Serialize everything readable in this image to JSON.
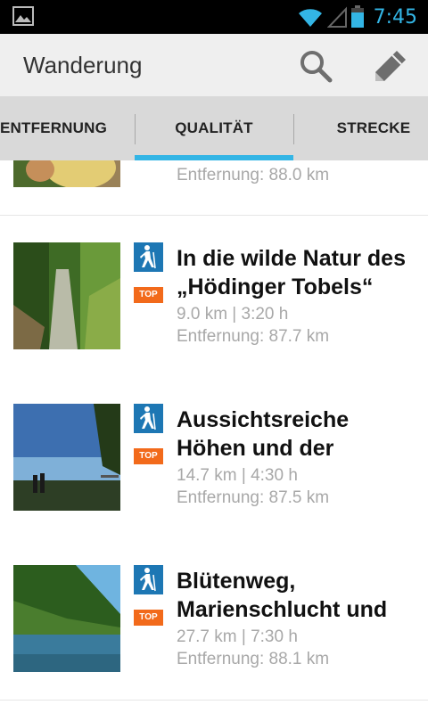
{
  "status_bar": {
    "time": "7:45",
    "icons": [
      "gallery-icon",
      "wifi-icon",
      "signal-icon",
      "battery-icon"
    ]
  },
  "action_bar": {
    "title": "Wanderung",
    "actions": [
      "search-icon",
      "pencil-icon"
    ]
  },
  "tabs": [
    {
      "label": "ENTFERNUNG",
      "selected": false
    },
    {
      "label": "QUALITÄT",
      "selected": true
    },
    {
      "label": "STRECKE",
      "selected": false
    }
  ],
  "list": {
    "items": [
      {
        "title_line1": "",
        "title_line2": "",
        "stats": "",
        "distance": "Entfernung:  88.0 km",
        "badge": "",
        "type_icon": "hiking-icon"
      },
      {
        "title_line1": "In die wilde Natur des",
        "title_line2": "„Hödinger Tobels“",
        "stats": "9.0 km | 3:20 h",
        "distance": "Entfernung:  87.7 km",
        "badge": "TOP",
        "type_icon": "hiking-icon"
      },
      {
        "title_line1": "Aussichtsreiche",
        "title_line2": "Höhen und der",
        "stats": "14.7 km | 4:30 h",
        "distance": "Entfernung:  87.5 km",
        "badge": "TOP",
        "type_icon": "hiking-icon"
      },
      {
        "title_line1": "Blütenweg,",
        "title_line2": "Marienschlucht und",
        "stats": "27.7 km | 7:30 h",
        "distance": "Entfernung:  88.1 km",
        "badge": "TOP",
        "type_icon": "hiking-icon"
      }
    ]
  },
  "colors": {
    "accent": "#33b5e5",
    "badge_top": "#f26a1b",
    "hiking_icon_bg": "#1d77b4"
  }
}
